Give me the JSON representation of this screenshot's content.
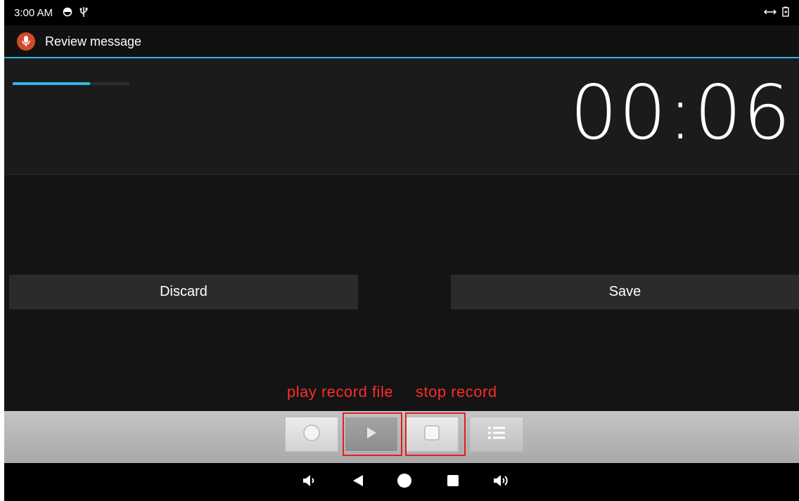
{
  "status_bar": {
    "time": "3:00 AM",
    "left_icons": [
      "alarm-icon",
      "usb-icon"
    ],
    "right_icons": [
      "data-transfer-icon",
      "battery-charging-icon"
    ]
  },
  "action_bar": {
    "title": "Review message",
    "app_icon": "microphone-icon"
  },
  "recorder": {
    "timer": "00:06",
    "progress": 0.66
  },
  "buttons": {
    "discard_label": "Discard",
    "save_label": "Save"
  },
  "annotations": {
    "play_label": "play record file",
    "stop_label": "stop record"
  },
  "toolbar": {
    "items": [
      "record-icon",
      "play-icon",
      "stop-icon",
      "list-icon"
    ]
  },
  "nav_bar": {
    "items": [
      "volume-down-icon",
      "back-icon",
      "home-icon",
      "recents-icon",
      "volume-up-icon"
    ]
  },
  "colors": {
    "accent": "#33b5e5",
    "annotation": "#ff2b2b"
  }
}
